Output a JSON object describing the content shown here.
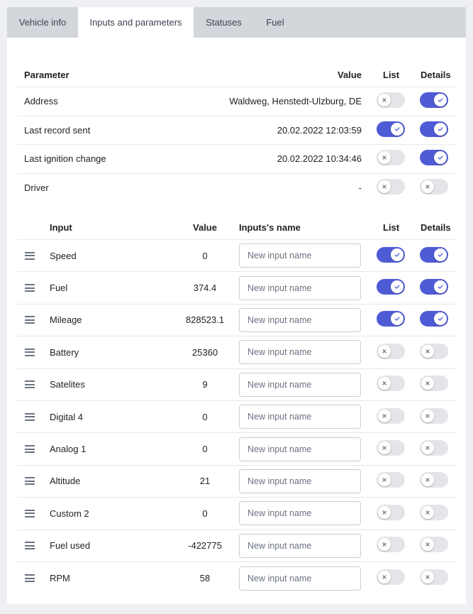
{
  "tabs": [
    {
      "label": "Vehicle info",
      "active": false
    },
    {
      "label": "Inputs and parameters",
      "active": true
    },
    {
      "label": "Statuses",
      "active": false
    },
    {
      "label": "Fuel",
      "active": false
    }
  ],
  "colors": {
    "toggle_on": "#4f5bd5",
    "toggle_off": "#e4e5e8"
  },
  "parameters": {
    "headers": {
      "parameter": "Parameter",
      "value": "Value",
      "list": "List",
      "details": "Details"
    },
    "rows": [
      {
        "name": "Address",
        "value": "Waldweg, Henstedt-Ulzburg, DE",
        "list": false,
        "details": true
      },
      {
        "name": "Last record sent",
        "value": "20.02.2022 12:03:59",
        "list": true,
        "details": true
      },
      {
        "name": "Last ignition change",
        "value": "20.02.2022 10:34:46",
        "list": false,
        "details": true
      },
      {
        "name": "Driver",
        "value": "-",
        "list": false,
        "details": false
      }
    ]
  },
  "inputs": {
    "headers": {
      "input": "Input",
      "value": "Value",
      "input_name": "Inputs's name",
      "list": "List",
      "details": "Details"
    },
    "placeholder": "New input name",
    "rows": [
      {
        "name": "Speed",
        "value": "0",
        "list": true,
        "details": true
      },
      {
        "name": "Fuel",
        "value": "374.4",
        "list": true,
        "details": true
      },
      {
        "name": "Mileage",
        "value": "828523.1",
        "list": true,
        "details": true
      },
      {
        "name": "Battery",
        "value": "25360",
        "list": false,
        "details": false
      },
      {
        "name": "Satelites",
        "value": "9",
        "list": false,
        "details": false
      },
      {
        "name": "Digital 4",
        "value": "0",
        "list": false,
        "details": false
      },
      {
        "name": "Analog 1",
        "value": "0",
        "list": false,
        "details": false
      },
      {
        "name": "Altitude",
        "value": "21",
        "list": false,
        "details": false
      },
      {
        "name": "Custom 2",
        "value": "0",
        "list": false,
        "details": false
      },
      {
        "name": "Fuel used",
        "value": "-422775",
        "list": false,
        "details": false
      },
      {
        "name": "RPM",
        "value": "58",
        "list": false,
        "details": false
      }
    ]
  }
}
